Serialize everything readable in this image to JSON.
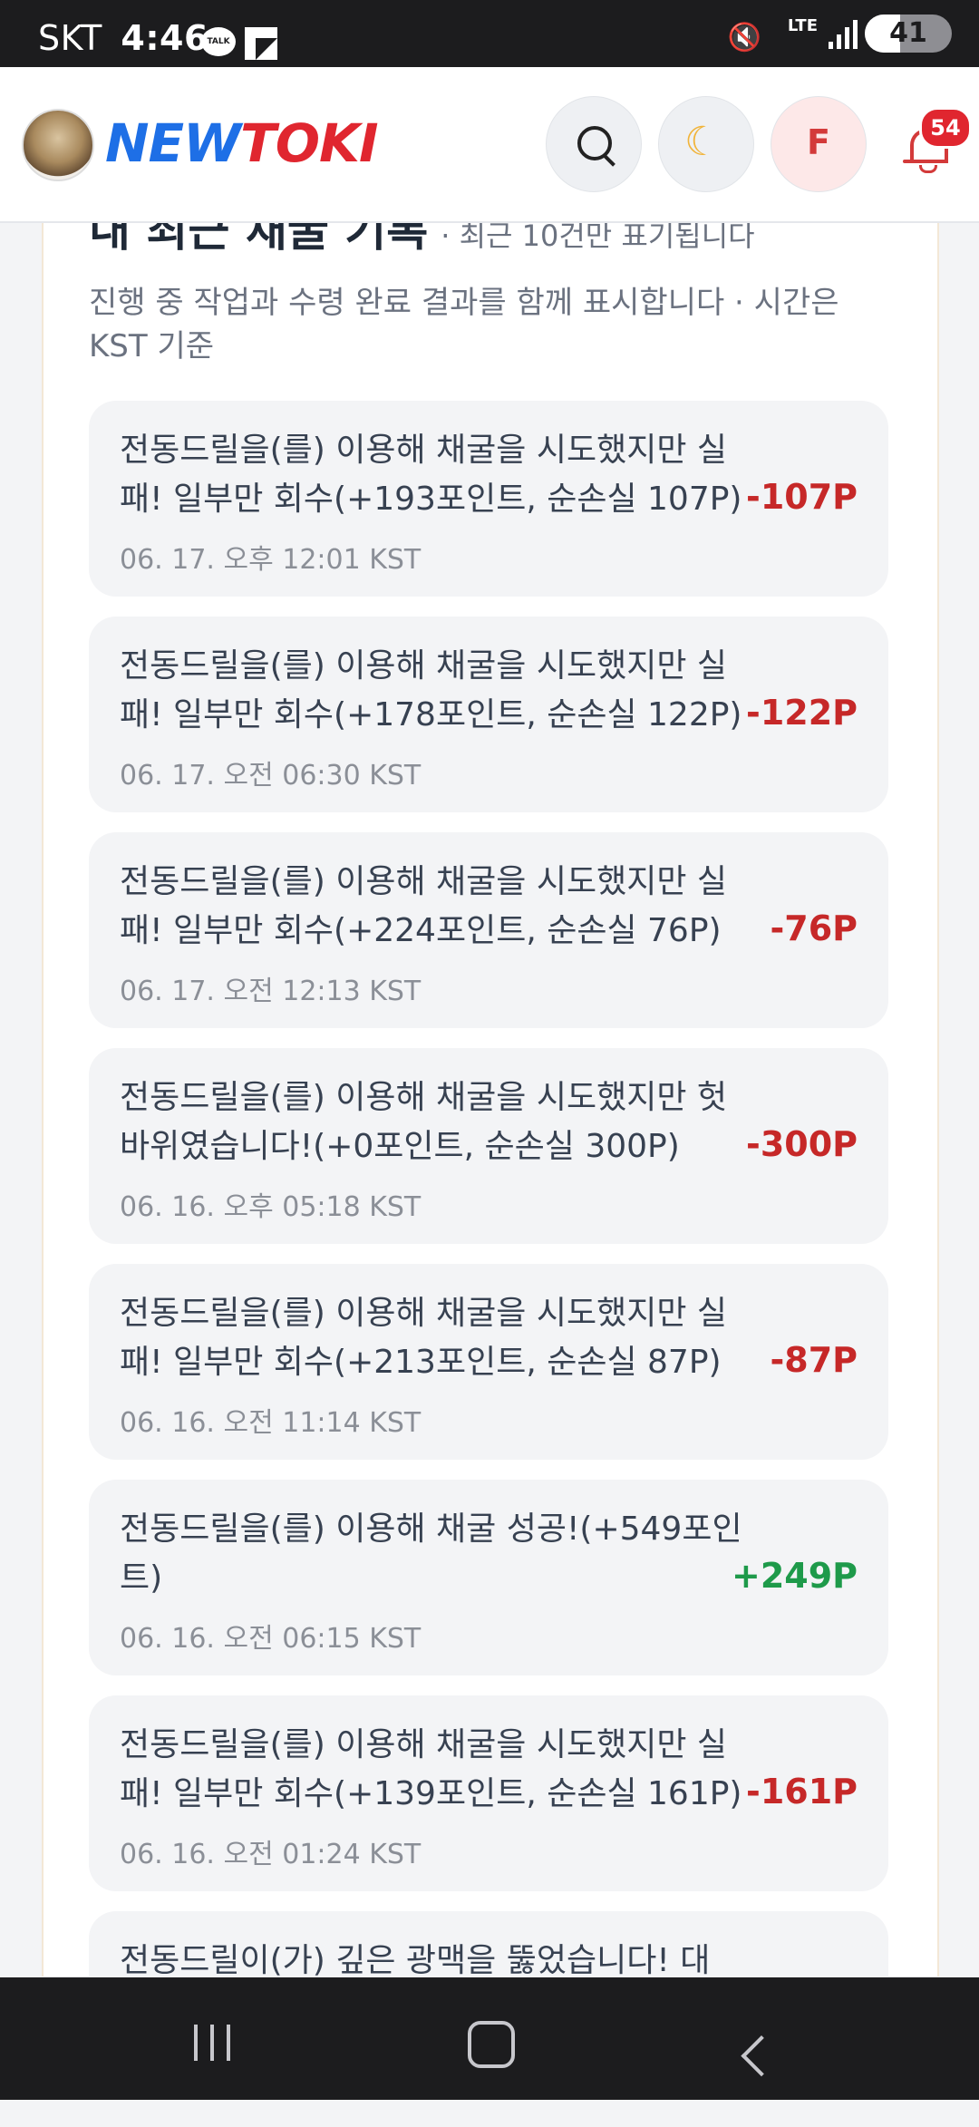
{
  "status_bar": {
    "carrier": "SKT",
    "time": "4:46",
    "talk_icon_label": "TALK",
    "network": "LTE",
    "battery": "41",
    "icons": [
      "talk-icon",
      "note-icon",
      "mute-icon",
      "lte-icon",
      "signal-icon",
      "battery-icon"
    ]
  },
  "header": {
    "logo_new": "NEW",
    "logo_toki": "TOKI",
    "user_initial": "F",
    "moon_glyph": "☾",
    "notification_count": "54",
    "accent_blue": "#1e6fe6",
    "accent_red": "#e0262f"
  },
  "section": {
    "title": "내 최근 채굴 기록",
    "note": "· 최근 10건만 표기됩니다",
    "description": "진행 중 작업과 수령 완료 결과를 함께 표시합니다 · 시간은 KST 기준"
  },
  "records": [
    {
      "message": "전동드릴을(를) 이용해 채굴을 시도했지만 실패! 일부만 회수(+193포인트, 순손실 107P)",
      "time": "06. 17. 오후 12:01 KST",
      "amount": "-107P"
    },
    {
      "message": "전동드릴을(를) 이용해 채굴을 시도했지만 실패! 일부만 회수(+178포인트, 순손실 122P)",
      "time": "06. 17. 오전 06:30 KST",
      "amount": "-122P"
    },
    {
      "message": "전동드릴을(를) 이용해 채굴을 시도했지만 실패! 일부만 회수(+224포인트, 순손실 76P)",
      "time": "06. 17. 오전 12:13 KST",
      "amount": "-76P"
    },
    {
      "message": "전동드릴을(를) 이용해 채굴을 시도했지만 헛바위였습니다!(+0포인트, 순손실 300P)",
      "time": "06. 16. 오후 05:18 KST",
      "amount": "-300P"
    },
    {
      "message": "전동드릴을(를) 이용해 채굴을 시도했지만 실패! 일부만 회수(+213포인트, 순손실 87P)",
      "time": "06. 16. 오전 11:14 KST",
      "amount": "-87P"
    },
    {
      "message": "전동드릴을(를) 이용해 채굴 성공!(+549포인트)",
      "time": "06. 16. 오전 06:15 KST",
      "amount": "+249P"
    },
    {
      "message": "전동드릴을(를) 이용해 채굴을 시도했지만 실패! 일부만 회수(+139포인트, 순손실 161P)",
      "time": "06. 16. 오전 01:24 KST",
      "amount": "-161P"
    },
    {
      "message": "전동드릴이(가) 깊은 광맥을 뚫었습니다! 대",
      "time": "",
      "amount": ""
    }
  ],
  "colors": {
    "loss": "#c62828",
    "gain": "#1e9a4a"
  },
  "navigation": {
    "icons": [
      "recent-apps-icon",
      "home-icon",
      "back-icon"
    ]
  }
}
